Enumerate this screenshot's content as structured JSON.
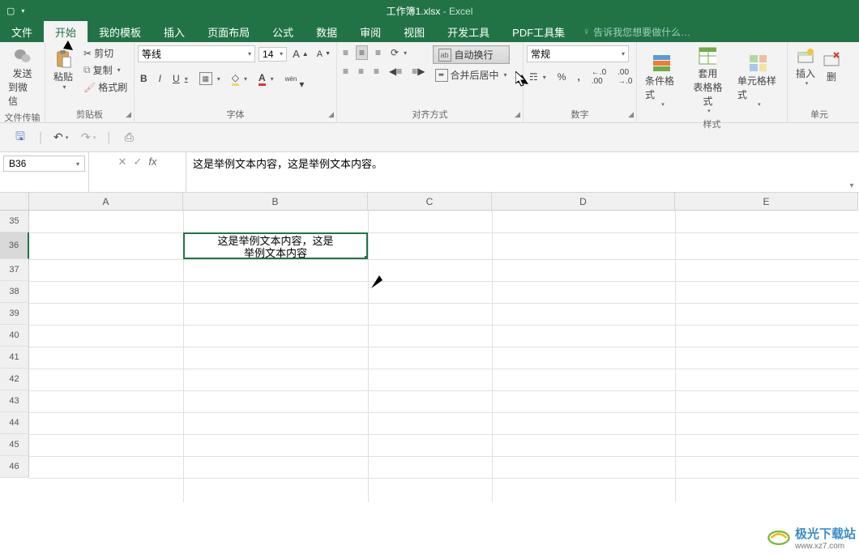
{
  "title": {
    "filename": "工作簿1.xlsx",
    "app": "Excel"
  },
  "tabs": {
    "file": "文件",
    "start": "开始",
    "templates": "我的模板",
    "insert": "插入",
    "layout": "页面布局",
    "formula": "公式",
    "data": "数据",
    "review": "审阅",
    "view": "视图",
    "dev": "开发工具",
    "pdf": "PDF工具集",
    "tellme": "告诉我您想要做什么…"
  },
  "ribbon": {
    "wechat": {
      "line1": "发送",
      "line2": "到微信",
      "group": "文件传输"
    },
    "clipboard": {
      "paste": "粘贴",
      "cut": "剪切",
      "copy": "复制",
      "format": "格式刷",
      "group": "剪贴板"
    },
    "font": {
      "name": "等线",
      "size": "14",
      "group": "字体"
    },
    "align": {
      "wrap": "自动换行",
      "merge": "合并后居中",
      "group": "对齐方式"
    },
    "number": {
      "format": "常规",
      "group": "数字"
    },
    "styles": {
      "cond": "条件格式",
      "table": "套用\n表格格式",
      "cell": "单元格样式",
      "group": "样式"
    },
    "cells": {
      "insert": "插入",
      "delete": "删",
      "group": "单元"
    }
  },
  "formula": {
    "ref": "B36",
    "text": "这是举例文本内容，这是举例文本内容。"
  },
  "columns": [
    "A",
    "B",
    "C",
    "D",
    "E"
  ],
  "rows": [
    "35",
    "36",
    "37",
    "38",
    "39",
    "40",
    "41",
    "42",
    "43",
    "44",
    "45",
    "46"
  ],
  "cell": {
    "line1": "这是举例文本内容，这是",
    "line2": "举例文本内容"
  },
  "watermark": {
    "name": "极光下载站",
    "url": "www.xz7.com"
  }
}
